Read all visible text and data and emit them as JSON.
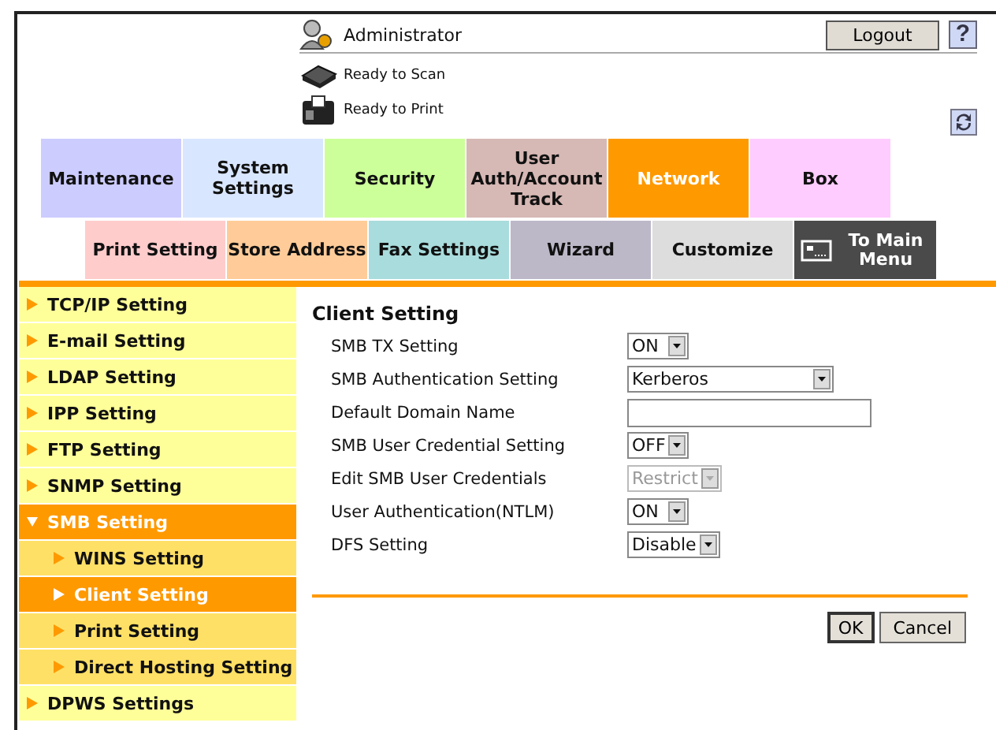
{
  "header": {
    "user": "Administrator",
    "logout": "Logout",
    "help": "?"
  },
  "status": [
    {
      "kind": "scan",
      "text": "Ready to Scan"
    },
    {
      "kind": "print",
      "text": "Ready to Print"
    }
  ],
  "main_tabs": [
    {
      "label": "Maintenance",
      "color": "#ccccff",
      "selected": false
    },
    {
      "label": "System Settings",
      "color": "#d9e6ff",
      "selected": false
    },
    {
      "label": "Security",
      "color": "#ccff99",
      "selected": false
    },
    {
      "label": "User Auth/Account Track",
      "color": "#d6b8b4",
      "selected": false
    },
    {
      "label": "Network",
      "color": "#ff9900",
      "selected": true
    },
    {
      "label": "Box",
      "color": "#ffccff",
      "selected": false
    }
  ],
  "sub_tabs": [
    {
      "label": "Print Setting",
      "kind": "tab",
      "color": "#ffcccc"
    },
    {
      "label": "Store Address",
      "kind": "tab",
      "color": "#ffcc99"
    },
    {
      "label": "Fax Settings",
      "kind": "tab",
      "color": "#a9dcdc"
    },
    {
      "label": "Wizard",
      "kind": "tab",
      "color": "#bdb8c8"
    },
    {
      "label": "Customize",
      "kind": "tab",
      "color": "#dddddd"
    },
    {
      "label": "To Main Menu",
      "kind": "home",
      "color": "#4a4a4a"
    }
  ],
  "sidebar": [
    {
      "label": "TCP/IP Setting",
      "selected": false,
      "expanded": false
    },
    {
      "label": "E-mail Setting",
      "selected": false,
      "expanded": false
    },
    {
      "label": "LDAP Setting",
      "selected": false,
      "expanded": false
    },
    {
      "label": "IPP Setting",
      "selected": false,
      "expanded": false
    },
    {
      "label": "FTP Setting",
      "selected": false,
      "expanded": false
    },
    {
      "label": "SNMP Setting",
      "selected": false,
      "expanded": false
    },
    {
      "label": "SMB Setting",
      "selected": false,
      "expanded": true,
      "children": [
        {
          "label": "WINS Setting",
          "selected": false
        },
        {
          "label": "Client Setting",
          "selected": true
        },
        {
          "label": "Print Setting",
          "selected": false
        },
        {
          "label": "Direct Hosting Setting",
          "selected": false
        }
      ]
    },
    {
      "label": "DPWS Settings",
      "selected": false,
      "expanded": false
    }
  ],
  "form": {
    "title": "Client Setting",
    "fields": [
      {
        "label": "SMB TX Setting",
        "kind": "select",
        "value": "ON",
        "disabled": false
      },
      {
        "label": "SMB Authentication Setting",
        "kind": "combo",
        "value": "Kerberos",
        "disabled": false
      },
      {
        "label": "Default Domain Name",
        "kind": "text",
        "disabled": false
      },
      {
        "label": "SMB User Credential Setting",
        "kind": "select",
        "value": "OFF",
        "disabled": false
      },
      {
        "label": "Edit SMB User Credentials",
        "kind": "select",
        "value": "Restrict",
        "disabled": true
      },
      {
        "label": "User Authentication(NTLM)",
        "kind": "select",
        "value": "ON",
        "disabled": false
      },
      {
        "label": "DFS Setting",
        "kind": "select",
        "value": "Disable",
        "disabled": false
      }
    ],
    "buttons": [
      {
        "label": "OK",
        "kind": "primary"
      },
      {
        "label": "Cancel",
        "kind": "normal"
      }
    ]
  }
}
